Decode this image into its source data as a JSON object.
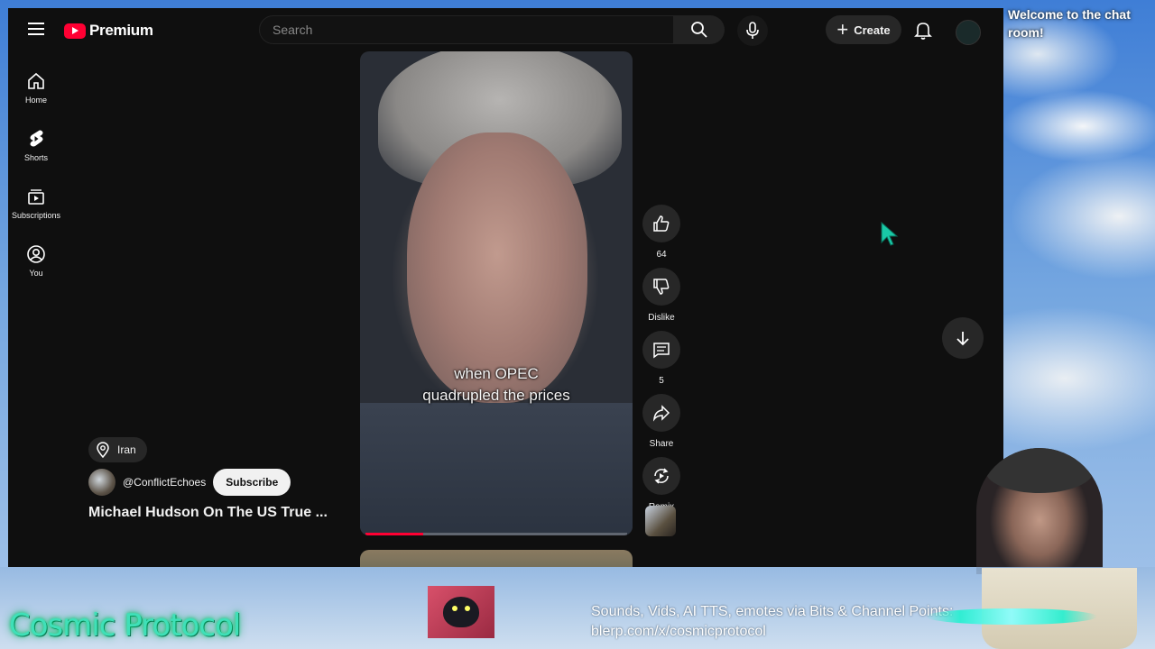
{
  "app": {
    "logo_text": "Premium"
  },
  "search": {
    "placeholder": "Search"
  },
  "header": {
    "create_label": "Create"
  },
  "sidebar": {
    "items": [
      {
        "label": "Home",
        "icon": "home-icon"
      },
      {
        "label": "Shorts",
        "icon": "shorts-icon"
      },
      {
        "label": "Subscriptions",
        "icon": "subscriptions-icon"
      },
      {
        "label": "You",
        "icon": "account-icon"
      }
    ]
  },
  "short": {
    "caption_line1": "when OPEC",
    "caption_line2": "quadrupled the prices",
    "location": "Iran",
    "channel_handle": "@ConflictEchoes",
    "subscribe_label": "Subscribe",
    "title": "Michael Hudson On The US True ...",
    "progress": 0.22
  },
  "actions": {
    "like_count": "64",
    "dislike_label": "Dislike",
    "comment_count": "5",
    "share_label": "Share",
    "remix_label": "Remix"
  },
  "stream_overlay": {
    "chat_welcome": "Welcome to the chat room!",
    "brand": "Cosmic Protocol",
    "promo_line1": "Sounds, Vids, AI TTS, emotes via Bits & Channel Points:",
    "promo_line2": "blerp.com/x/cosmicprotocol"
  },
  "colors": {
    "accent_red": "#ff0033",
    "brand_teal": "#3fe0b8",
    "background": "#0f0f0f"
  }
}
